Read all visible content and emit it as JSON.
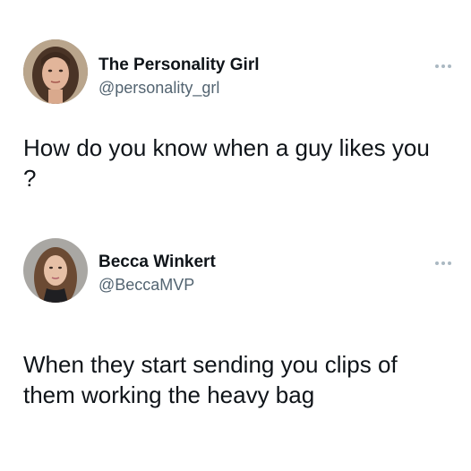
{
  "tweets": [
    {
      "display_name": "The Personality Girl",
      "handle": "@personality_grl",
      "text": "How do you know when a guy likes you ?",
      "avatar": "profile-photo-woman-dark-hair",
      "more_icon": "more-options-icon"
    },
    {
      "display_name": "Becca Winkert",
      "handle": "@BeccaMVP",
      "text": "When they start sending you clips of them working the heavy bag",
      "avatar": "profile-photo-woman-long-hair",
      "more_icon": "more-options-icon"
    }
  ],
  "colors": {
    "text_primary": "#0f1419",
    "text_secondary": "#536471",
    "background": "#ffffff"
  }
}
